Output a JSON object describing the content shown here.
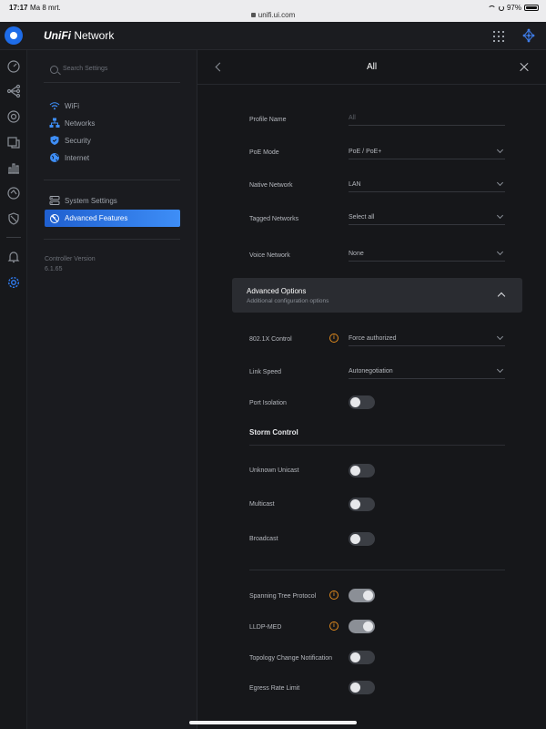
{
  "status_bar": {
    "time": "17:17",
    "date": "Ma 8 mrt.",
    "url": "unifi.ui.com",
    "battery": "97%",
    "battery_level": 0.97
  },
  "header": {
    "brand_uni": "UniFi",
    "brand_app": "Network"
  },
  "rail": {
    "icons": [
      "dashboard-icon",
      "topology-icon",
      "devices-icon",
      "clients-icon",
      "statistics-icon",
      "insights-icon",
      "shield-icon",
      "alerts-icon",
      "settings-icon"
    ]
  },
  "settings": {
    "search_placeholder": "Search Settings",
    "nav": [
      {
        "label": "WiFi",
        "icon": "wifi-icon"
      },
      {
        "label": "Networks",
        "icon": "networks-icon"
      },
      {
        "label": "Security",
        "icon": "security-icon"
      },
      {
        "label": "Internet",
        "icon": "globe-icon"
      },
      {
        "label": "System Settings",
        "icon": "system-icon"
      },
      {
        "label": "Advanced Features",
        "icon": "advanced-icon",
        "active": true
      }
    ],
    "controller_version_label": "Controller Version",
    "controller_version": "6.1.65"
  },
  "main": {
    "title": "All",
    "fields": [
      {
        "label": "Profile Name",
        "value": "All",
        "placeholder": true
      },
      {
        "label": "PoE Mode",
        "value": "PoE / PoE+"
      },
      {
        "label": "Native Network",
        "value": "LAN"
      },
      {
        "label": "Tagged Networks",
        "value": "Select all"
      },
      {
        "label": "Voice Network",
        "value": "None"
      }
    ],
    "advanced": {
      "title": "Advanced Options",
      "subtitle": "Additional configuration options",
      "dot1x_label": "802.1X Control",
      "dot1x_value": "Force authorized",
      "link_speed_label": "Link Speed",
      "link_speed_value": "Autonegotiation",
      "port_isolation_label": "Port Isolation",
      "port_isolation": false,
      "storm_control_title": "Storm Control",
      "storm": [
        {
          "label": "Unknown Unicast",
          "on": false
        },
        {
          "label": "Multicast",
          "on": false
        },
        {
          "label": "Broadcast",
          "on": false
        }
      ],
      "stp_label": "Spanning Tree Protocol",
      "stp": true,
      "lldp_label": "LLDP-MED",
      "lldp": true,
      "tcn_label": "Topology Change Notification",
      "tcn": false,
      "egress_label": "Egress Rate Limit",
      "egress": false
    }
  },
  "colors": {
    "accent": "#1e6ce8",
    "active_gradient_end": "#3e8ef7",
    "warning": "#e08a1e",
    "background": "#16171a"
  }
}
